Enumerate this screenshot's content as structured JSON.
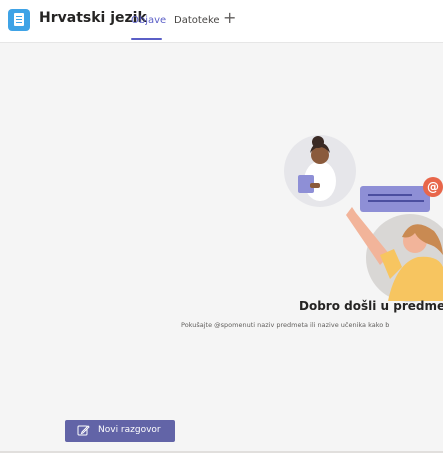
{
  "header": {
    "team_name": "Hrvatski jezik",
    "tabs": [
      {
        "label": "Objave",
        "active": true
      },
      {
        "label": "Datoteke",
        "active": false
      }
    ],
    "add_tab_symbol": "+"
  },
  "main": {
    "welcome_title": "Dobro došli u predmet!",
    "welcome_hint": "Pokušajte @spomenuti naziv predmeta ili nazive učenika kako b",
    "mention_badge": "@"
  },
  "footer": {
    "new_conversation_label": "Novi razgovor",
    "new_conversation_icon": "compose-icon"
  },
  "colors": {
    "accent": "#5b5fc7",
    "button": "#6264a7",
    "team_icon": "#3fa3e6",
    "mention_badge": "#e8664a"
  }
}
